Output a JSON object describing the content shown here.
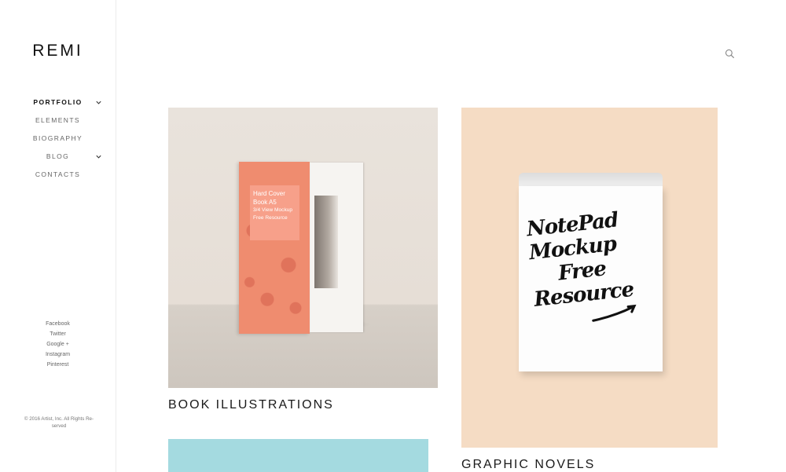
{
  "brand": {
    "logo": "REMI"
  },
  "nav": [
    {
      "label": "PORTFOLIO",
      "active": true,
      "has_submenu": true
    },
    {
      "label": "ELEMENTS",
      "active": false,
      "has_submenu": false
    },
    {
      "label": "BIOGRAPHY",
      "active": false,
      "has_submenu": false
    },
    {
      "label": "BLOG",
      "active": false,
      "has_submenu": true
    },
    {
      "label": "CONTACTS",
      "active": false,
      "has_submenu": false
    }
  ],
  "social": [
    "Facebook",
    "Twitter",
    "Google +",
    "Instagram",
    "Pinterest"
  ],
  "copyright": "© 2016 Artist, Inc. All Rights Re-served",
  "header": {
    "search_icon": "search-icon"
  },
  "portfolio": [
    {
      "caption": "BOOK ILLUSTRATIONS",
      "image_text": [
        "Hard Cover",
        "Book A5",
        "3/4 View Mockup",
        "Free Resource"
      ]
    },
    {
      "caption": "GRAPHIC NOVELS",
      "image_text": [
        "NotePad",
        "Mockup",
        "Free",
        "Resource"
      ]
    },
    {
      "caption": ""
    }
  ],
  "colors": {
    "background": "#ffffff",
    "sidebar_border": "#ececec",
    "book_cover": "#ef8c6f",
    "notepad_background": "#f5dcc4",
    "teal_card": "#a4dae0"
  }
}
